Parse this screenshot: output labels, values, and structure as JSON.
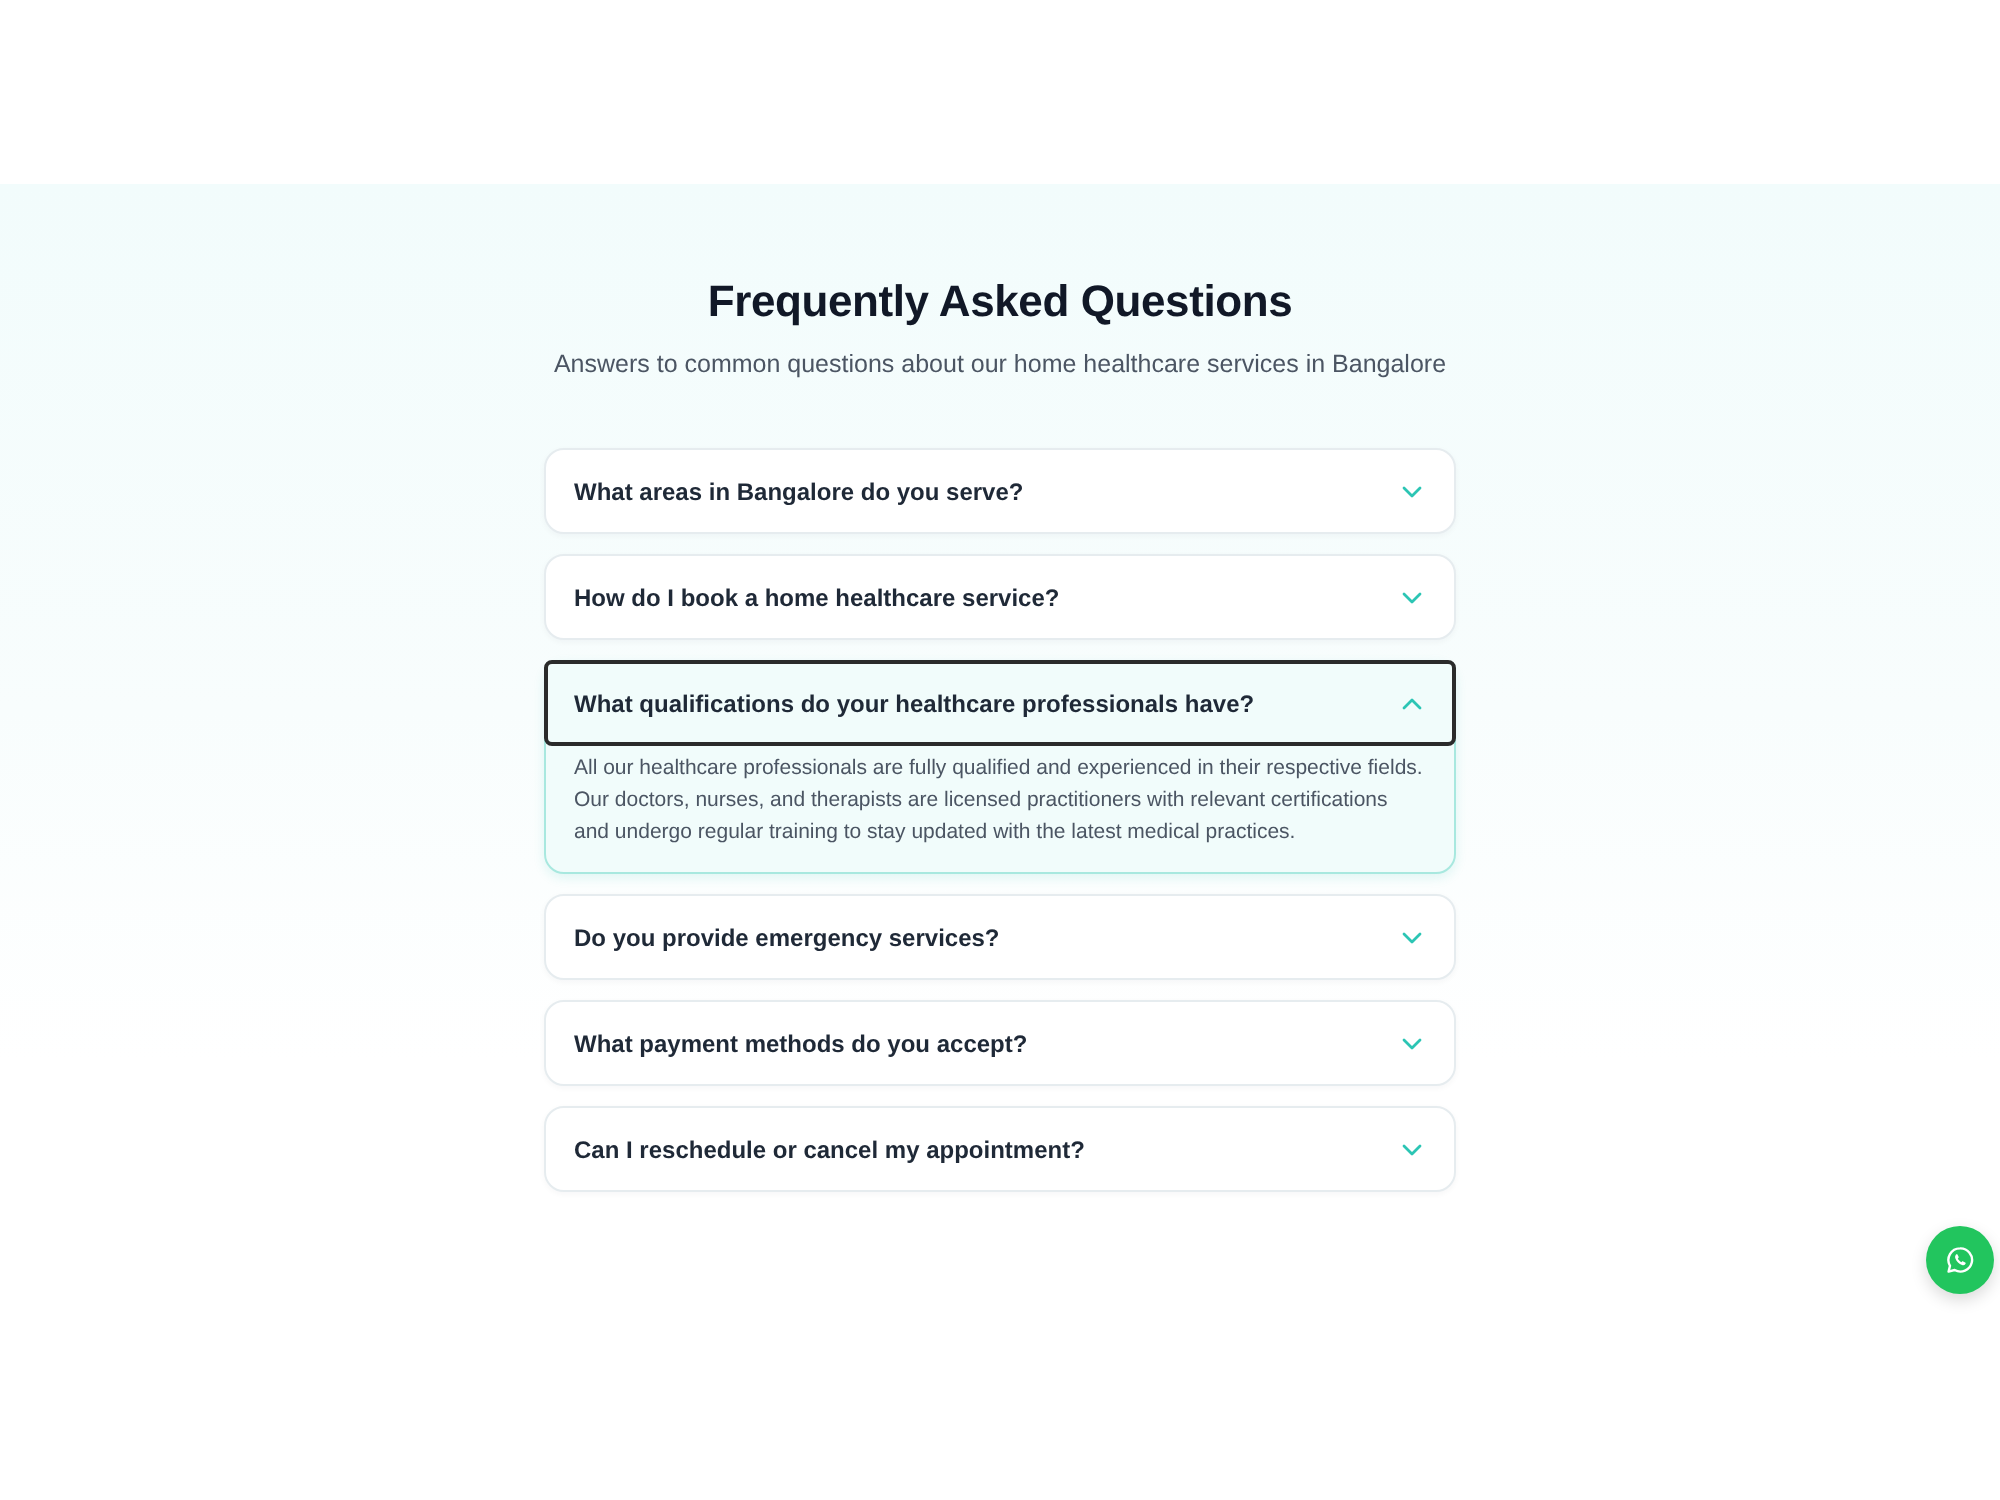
{
  "section": {
    "title": "Frequently Asked Questions",
    "subtitle": "Answers to common questions about our home healthcare services in Bangalore"
  },
  "faqs": [
    {
      "question": "What areas in Bangalore do you serve?",
      "expanded": false,
      "focused": false
    },
    {
      "question": "How do I book a home healthcare service?",
      "expanded": false,
      "focused": false
    },
    {
      "question": "What qualifications do your healthcare professionals have?",
      "expanded": true,
      "focused": true,
      "answer": "All our healthcare professionals are fully qualified and experienced in their respective fields. Our doctors, nurses, and therapists are licensed practitioners with relevant certifications and undergo regular training to stay updated with the latest medical practices."
    },
    {
      "question": "Do you provide emergency services?",
      "expanded": false,
      "focused": false
    },
    {
      "question": "What payment methods do you accept?",
      "expanded": false,
      "focused": false
    },
    {
      "question": "Can I reschedule or cancel my appointment?",
      "expanded": false,
      "focused": false
    }
  ]
}
